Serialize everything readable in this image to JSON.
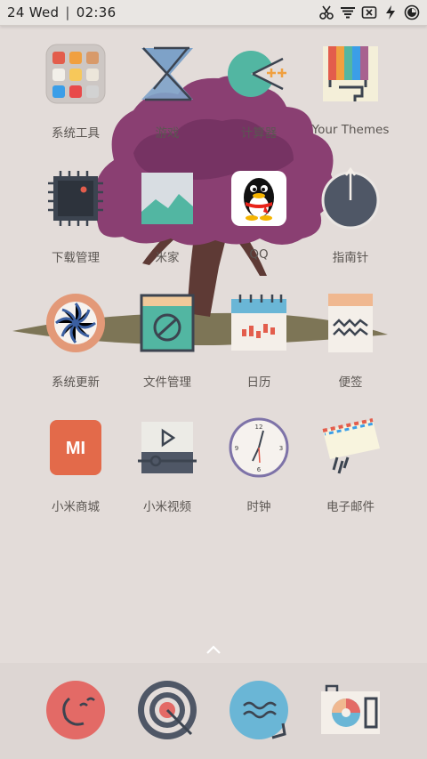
{
  "status_bar": {
    "date_day": "24",
    "weekday": "Wed",
    "time": "02:36",
    "icons": [
      "scissors-icon",
      "wifi-icon",
      "sim-card-off-icon",
      "charging-bolt-icon",
      "battery-icon"
    ]
  },
  "home": {
    "apps": [
      {
        "label": "系统工具",
        "icon": "folder-icon"
      },
      {
        "label": "游戏",
        "icon": "game-icon"
      },
      {
        "label": "计算器",
        "icon": "calculator-icon"
      },
      {
        "label": "Your Themes",
        "icon": "themes-icon"
      },
      {
        "label": "下载管理",
        "icon": "download-chip-icon"
      },
      {
        "label": "米家",
        "icon": "mijia-icon"
      },
      {
        "label": "QQ",
        "icon": "qq-penguin-icon"
      },
      {
        "label": "指南针",
        "icon": "compass-icon"
      },
      {
        "label": "系统更新",
        "icon": "system-update-icon"
      },
      {
        "label": "文件管理",
        "icon": "file-manager-icon"
      },
      {
        "label": "日历",
        "icon": "calendar-icon"
      },
      {
        "label": "便签",
        "icon": "notes-icon"
      },
      {
        "label": "小米商城",
        "icon": "mi-store-icon"
      },
      {
        "label": "小米视频",
        "icon": "mi-video-icon"
      },
      {
        "label": "时钟",
        "icon": "clock-icon"
      },
      {
        "label": "电子邮件",
        "icon": "email-icon"
      }
    ],
    "clock_face": {
      "n12": "12",
      "n3": "3",
      "n6": "6",
      "n9": "9"
    },
    "mi_logo": "MI"
  },
  "dock": {
    "apps": [
      {
        "icon": "phone-icon"
      },
      {
        "icon": "target-icon"
      },
      {
        "icon": "messages-icon"
      },
      {
        "icon": "camera-icon"
      }
    ]
  },
  "colors": {
    "background": "#e3dcd9",
    "tree_canopy": "#8a3f72",
    "tree_trunk": "#5e3a35",
    "ground": "#7d7556"
  }
}
